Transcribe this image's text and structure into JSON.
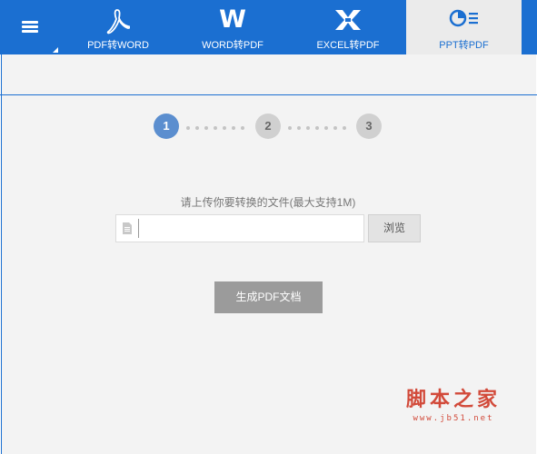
{
  "nav": {
    "tabs": [
      {
        "label": "PDF转WORD",
        "icon": "pdf-acrobat-icon"
      },
      {
        "label": "WORD转PDF",
        "icon": "word-w-icon",
        "glyph": "W"
      },
      {
        "label": "EXCEL转PDF",
        "icon": "excel-x-icon"
      },
      {
        "label": "PPT转PDF",
        "icon": "ppt-pie-icon",
        "active": true
      }
    ]
  },
  "steps": [
    "1",
    "2",
    "3"
  ],
  "upload": {
    "hint": "请上传你要转换的文件(最大支持1M)",
    "value": "",
    "browse_label": "浏览"
  },
  "actions": {
    "generate_label": "生成PDF文档"
  },
  "watermark": {
    "text": "脚本之家",
    "url": "www.jb51.net"
  },
  "colors": {
    "brand": "#1b6fd1",
    "step_active": "#5b8ecf",
    "button_disabled": "#9b9b9b",
    "watermark": "#d24a3a"
  }
}
